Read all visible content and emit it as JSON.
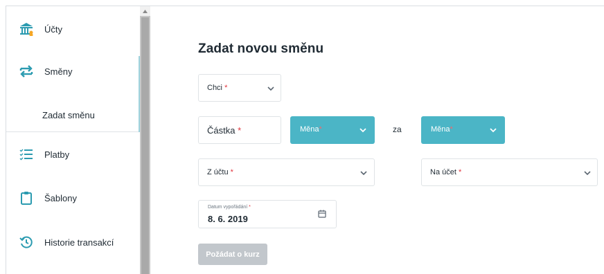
{
  "sidebar": {
    "items": [
      {
        "label": "Účty",
        "icon": "bank-icon"
      },
      {
        "label": "Směny",
        "icon": "exchange-icon"
      },
      {
        "label": "Platby",
        "icon": "list-check-icon"
      },
      {
        "label": "Šablony",
        "icon": "clipboard-icon"
      },
      {
        "label": "Historie transakcí",
        "icon": "history-icon"
      }
    ],
    "sub_item": {
      "label": "Zadat směnu"
    }
  },
  "form": {
    "title": "Zadat novou směnu",
    "want_select": {
      "label": "Chci"
    },
    "amount_input": {
      "label": "Částka"
    },
    "currency_from": {
      "label": "Měna"
    },
    "za_label": "za",
    "currency_to": {
      "label": "Měna"
    },
    "from_account": {
      "label": "Z účtu"
    },
    "to_account": {
      "label": "Na účet"
    },
    "settlement_date": {
      "label": "Datum vypořádání",
      "value": "8. 6. 2019"
    },
    "required_mark": "*",
    "submit_button": "Požádat o kurz"
  },
  "colors": {
    "accent": "#4bb5c6",
    "required": "#e0333c",
    "disabled": "#c2c7cc",
    "icon": "#2b9bb0"
  }
}
